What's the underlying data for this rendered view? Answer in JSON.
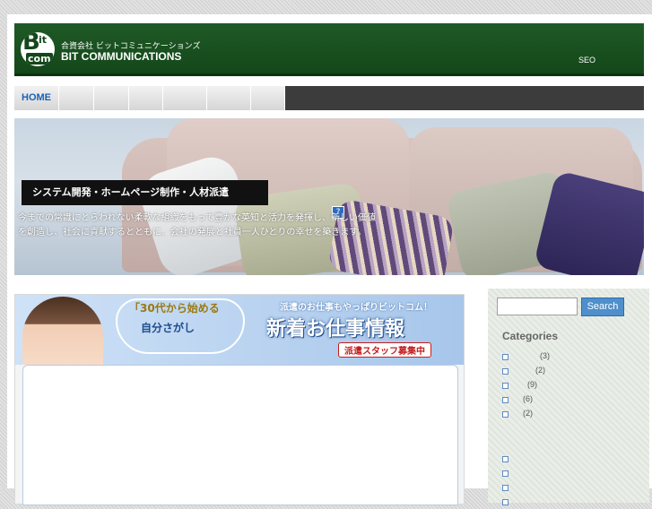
{
  "header": {
    "logo_text": "Bit com",
    "company_jp": "合資会社 ビットコミュニケーションズ",
    "company_en": "BIT COMMUNICATIONS",
    "seo_link": "SEO"
  },
  "nav": {
    "items": [
      {
        "label": "HOME"
      },
      {
        "label": ""
      },
      {
        "label": ""
      },
      {
        "label": ""
      },
      {
        "label": ""
      },
      {
        "label": ""
      },
      {
        "label": ""
      }
    ]
  },
  "hero": {
    "title": "システム開発・ホームページ制作・人材派遣",
    "description": "今までの常識にとらわれない柔軟な組織をもって豊かな英知と活力を発揮し、新しい価値を創造し、社会に貢献するとともに、会社の発展と社員一人ひとりの幸せを築きます。"
  },
  "banner": {
    "bubble_line1": "「30代から始める",
    "bubble_line2": "自分さがし",
    "tagline": "派遣のお仕事もやっぱりビットコム！",
    "headline": "新着お仕事情報",
    "recruit": "派遣スタッフ募集中"
  },
  "sidebar": {
    "search_placeholder": "",
    "search_button": "Search",
    "categories_title": "Categories",
    "categories": [
      {
        "label": "",
        "count": "(3)"
      },
      {
        "label": "",
        "count": "(2)"
      },
      {
        "label": "",
        "count": "(9)"
      },
      {
        "label": "",
        "count": "(6)"
      },
      {
        "label": "",
        "count": "(2)"
      }
    ],
    "links": [
      "",
      "",
      "",
      ""
    ]
  },
  "colors": {
    "header_green": "#14471a",
    "nav_dark": "#3c3c3c",
    "home_blue": "#1a62b5",
    "search_button": "#4f8fcc"
  }
}
